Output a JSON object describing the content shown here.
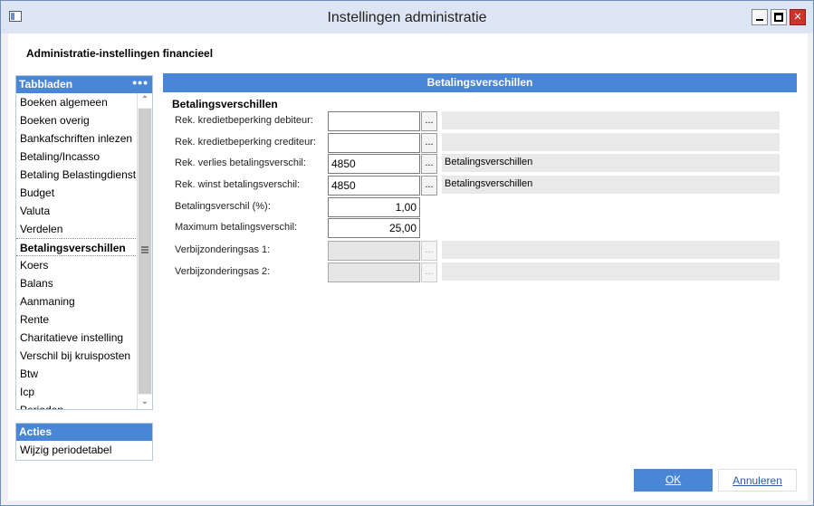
{
  "window": {
    "title": "Instellingen administratie"
  },
  "page": {
    "title": "Administratie-instellingen financieel"
  },
  "tabs_panel": {
    "header": "Tabbladen",
    "more_glyph": "•••",
    "items": [
      "Boeken algemeen",
      "Boeken overig",
      "Bankafschriften inlezen",
      "Betaling/Incasso",
      "Betaling Belastingdienst",
      "Budget",
      "Valuta",
      "Verdelen",
      "Betalingsverschillen",
      "Koers",
      "Balans",
      "Aanmaning",
      "Rente",
      "Charitatieve instelling",
      "Verschil bij kruisposten",
      "Btw",
      "Icp",
      "Perioden"
    ],
    "active_index": 8
  },
  "actions_panel": {
    "header": "Acties",
    "items": [
      "Wijzig periodetabel"
    ]
  },
  "section": {
    "header": "Betalingsverschillen",
    "group_title": "Betalingsverschillen",
    "fields": [
      {
        "label": "Rek. kredietbeperking debiteur:",
        "value": "",
        "description": "",
        "lookup": "..."
      },
      {
        "label": "Rek. kredietbeperking crediteur:",
        "value": "",
        "description": "",
        "lookup": "..."
      },
      {
        "label": "Rek. verlies betalingsverschil:",
        "value": "4850",
        "description": "Betalingsverschillen",
        "lookup": "..."
      },
      {
        "label": "Rek. winst betalingsverschil:",
        "value": "4850",
        "description": "Betalingsverschillen",
        "lookup": "..."
      },
      {
        "label": "Betalingsverschil (%):",
        "value": "1,00"
      },
      {
        "label": "Maximum betalingsverschil:",
        "value": "25,00"
      },
      {
        "label": "Verbijzonderingsas 1:",
        "value": "",
        "description": "",
        "lookup": "..."
      },
      {
        "label": "Verbijzonderingsas 2:",
        "value": "",
        "description": "",
        "lookup": "..."
      }
    ]
  },
  "buttons": {
    "ok": "OK",
    "cancel": "Annuleren"
  },
  "colors": {
    "accent": "#4a86d6",
    "close": "#c9362b"
  }
}
